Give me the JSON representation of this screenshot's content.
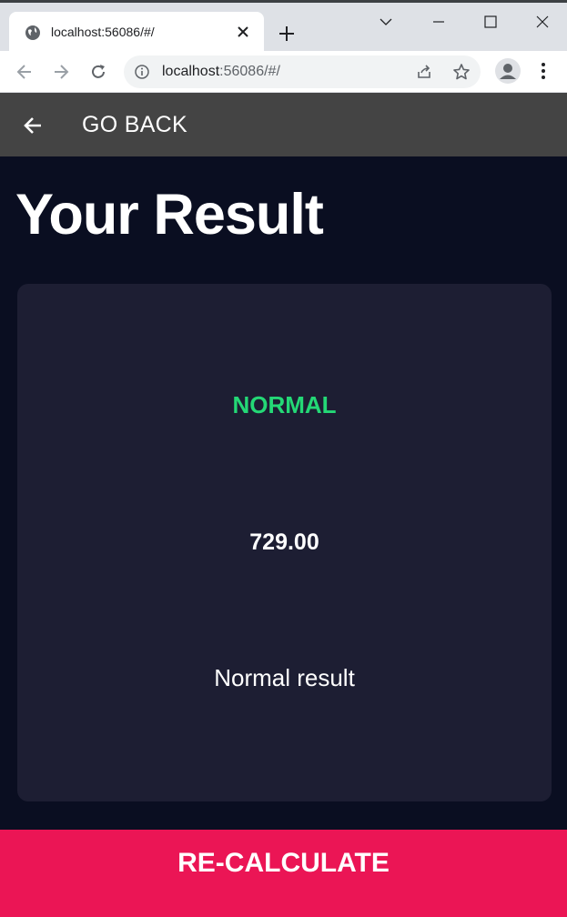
{
  "browser": {
    "tab_title": "localhost:56086/#/",
    "url_host": "localhost",
    "url_rest": ":56086/#/"
  },
  "appbar": {
    "back_label": "GO BACK"
  },
  "page": {
    "title": "Your Result"
  },
  "result": {
    "status": "NORMAL",
    "value": "729.00",
    "description": "Normal result"
  },
  "actions": {
    "recalculate_label": "RE-CALCULATE"
  },
  "colors": {
    "background": "#0a0e21",
    "card": "#1d1e33",
    "status_green": "#24d876",
    "accent_pink": "#eb1555",
    "appbar": "#444444"
  },
  "icons": {
    "back": "arrow-left-icon",
    "tab_favicon": "globe-icon",
    "tab_close": "close-icon",
    "new_tab": "plus-icon",
    "nav_back": "arrow-left-icon",
    "nav_forward": "arrow-right-icon",
    "reload": "reload-icon",
    "site_info": "info-icon",
    "share": "share-icon",
    "bookmark": "star-icon",
    "profile": "profile-icon",
    "menu": "more-vert-icon"
  }
}
